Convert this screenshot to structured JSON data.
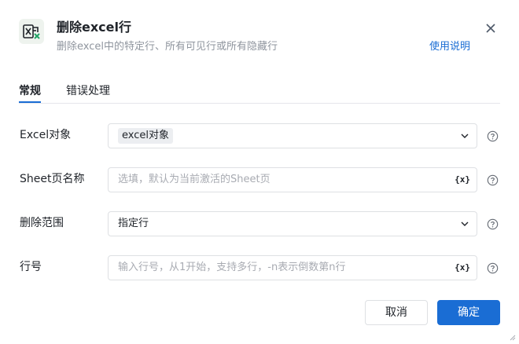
{
  "header": {
    "title": "删除excel行",
    "subtitle": "删除excel中的特定行、所有可见行或所有隐藏行",
    "help_link": "使用说明",
    "icon": "excel-delete-icon"
  },
  "tabs": [
    {
      "label": "常规",
      "active": true
    },
    {
      "label": "错误处理",
      "active": false
    }
  ],
  "form": {
    "excel_object": {
      "label": "Excel对象",
      "value": "excel对象"
    },
    "sheet_name": {
      "label": "Sheet页名称",
      "placeholder": "选填，默认为当前激活的Sheet页",
      "var_button": "{x}"
    },
    "delete_range": {
      "label": "删除范围",
      "value": "指定行"
    },
    "row_number": {
      "label": "行号",
      "placeholder": "输入行号，从1开始，支持多行，-n表示倒数第n行",
      "var_button": "{x}"
    }
  },
  "footer": {
    "cancel_label": "取消",
    "ok_label": "确定"
  },
  "colors": {
    "accent": "#1a6dd4",
    "excel_green": "#21a366"
  }
}
